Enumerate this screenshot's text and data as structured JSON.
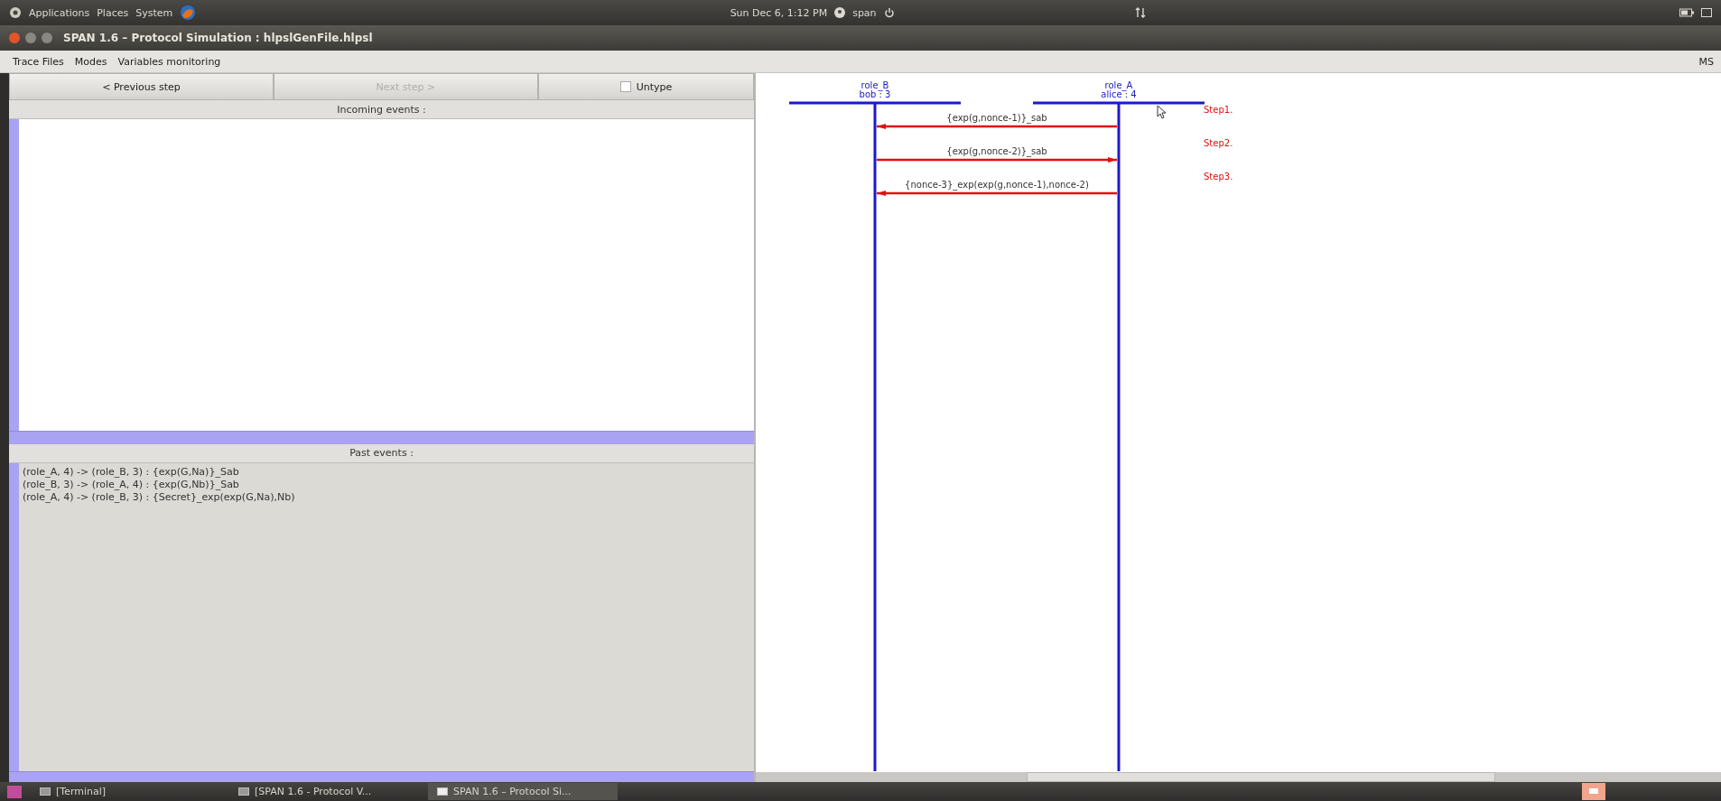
{
  "top_panel": {
    "menus": [
      "Applications",
      "Places",
      "System"
    ],
    "clock": "Sun Dec 6, 1:12 PM",
    "user": "span"
  },
  "window": {
    "title": "SPAN 1.6 – Protocol Simulation : hlpslGenFile.hlpsl"
  },
  "menu_bar": {
    "items": [
      "Trace Files",
      "Modes",
      "Variables monitoring"
    ],
    "right_text": "MS"
  },
  "controls": {
    "buttons": [
      {
        "label": "< Previous step",
        "disabled": false
      },
      {
        "label": "Next step >",
        "disabled": true
      }
    ],
    "untype": {
      "label": "Untype",
      "checked": false
    }
  },
  "incoming_events": {
    "title": "Incoming events :"
  },
  "past_events": {
    "title": "Past events :",
    "lines": [
      "(role_A, 4) -> (role_B, 3) : {exp(G,Na)}_Sab",
      "(role_B, 3) -> (role_A, 4) : {exp(G,Nb)}_Sab",
      "(role_A, 4) -> (role_B, 3) : {Secret}_exp(exp(G,Na),Nb)"
    ]
  },
  "diagram": {
    "roles": [
      {
        "name": "role_B",
        "instance": "bob : 3"
      },
      {
        "name": "role_A",
        "instance": "alice : 4"
      }
    ],
    "messages": [
      {
        "label": "{exp(g,nonce-1)}_sab",
        "kind": "leftward"
      },
      {
        "label": "{exp(g,nonce-2)}_sab",
        "kind": "rightward"
      },
      {
        "label": "{nonce-3}_exp(exp(g,nonce-1),nonce-2)",
        "kind": "leftward"
      }
    ],
    "steps": [
      "Step1.",
      "Step2.",
      "Step3."
    ]
  },
  "taskbar": {
    "items": [
      {
        "label": "[Terminal]",
        "selected": false
      },
      {
        "label": "[SPAN 1.6 - Protocol V...",
        "selected": false
      },
      {
        "label": "SPAN 1.6 – Protocol Si...",
        "selected": true
      }
    ]
  }
}
